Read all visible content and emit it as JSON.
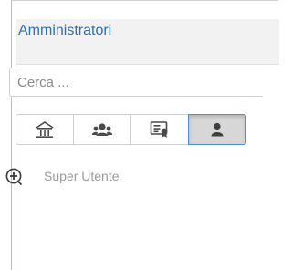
{
  "panel": {
    "title": "Amministratori"
  },
  "search": {
    "placeholder": "Cerca ..."
  },
  "filter_tabs": [
    {
      "icon": "institution-icon",
      "active": false
    },
    {
      "icon": "group-icon",
      "active": false
    },
    {
      "icon": "id-card-icon",
      "active": false
    },
    {
      "icon": "user-icon",
      "active": true
    }
  ],
  "list": {
    "items": [
      {
        "label": "Super Utente",
        "icon": "add-circle-icon"
      }
    ]
  },
  "colors": {
    "title": "#2f6fb3",
    "active_tab_bg": "#d7d7d7",
    "active_tab_border": "#4a90d9",
    "icon": "#4a4a4a",
    "item_text": "#9a9a9a"
  }
}
